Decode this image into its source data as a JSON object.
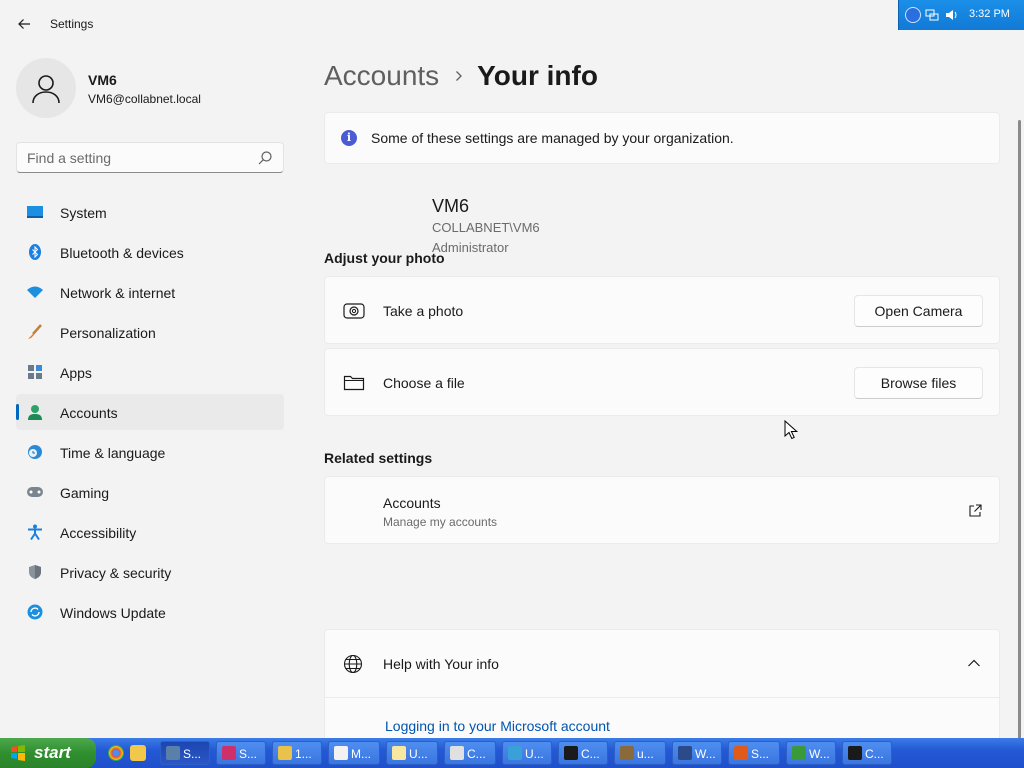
{
  "window": {
    "title": "Settings",
    "minimize_glyph": "—",
    "maximize_glyph": "❐",
    "close_glyph": "✕"
  },
  "profile": {
    "name": "VM6",
    "email": "VM6@collabnet.local"
  },
  "search": {
    "placeholder": "Find a setting"
  },
  "sidebar": {
    "items": [
      {
        "label": "System",
        "icon": "system-icon",
        "active": false
      },
      {
        "label": "Bluetooth & devices",
        "icon": "bluetooth-icon",
        "active": false
      },
      {
        "label": "Network & internet",
        "icon": "wifi-icon",
        "active": false
      },
      {
        "label": "Personalization",
        "icon": "brush-icon",
        "active": false
      },
      {
        "label": "Apps",
        "icon": "apps-icon",
        "active": false
      },
      {
        "label": "Accounts",
        "icon": "accounts-icon",
        "active": true
      },
      {
        "label": "Time & language",
        "icon": "clock-globe-icon",
        "active": false
      },
      {
        "label": "Gaming",
        "icon": "gamepad-icon",
        "active": false
      },
      {
        "label": "Accessibility",
        "icon": "accessibility-icon",
        "active": false
      },
      {
        "label": "Privacy & security",
        "icon": "shield-icon",
        "active": false
      },
      {
        "label": "Windows Update",
        "icon": "update-icon",
        "active": false
      }
    ]
  },
  "breadcrumb": {
    "parent": "Accounts",
    "current": "Your info"
  },
  "notice": {
    "text": "Some of these settings are managed by your organization."
  },
  "user": {
    "name": "VM6",
    "domain_account": "COLLABNET\\VM6",
    "role": "Administrator"
  },
  "adjust_photo": {
    "title": "Adjust your photo",
    "take_photo_label": "Take a photo",
    "open_camera_button": "Open Camera",
    "choose_file_label": "Choose a file",
    "browse_files_button": "Browse files"
  },
  "related": {
    "title": "Related settings",
    "accounts_title": "Accounts",
    "accounts_subtitle": "Manage my accounts"
  },
  "help": {
    "title": "Help with Your info",
    "link": "Logging in to your Microsoft account"
  },
  "taskbar": {
    "start_label": "start",
    "items": [
      {
        "label": "S...",
        "color": "#5a7fa8",
        "active": true
      },
      {
        "label": "S...",
        "color": "#d0306a",
        "active": false
      },
      {
        "label": "1...",
        "color": "#e8c24a",
        "active": false
      },
      {
        "label": "M...",
        "color": "#f2f2f2",
        "active": false
      },
      {
        "label": "U...",
        "color": "#f7e7a0",
        "active": false
      },
      {
        "label": "C...",
        "color": "#e0e0e0",
        "active": false
      },
      {
        "label": "U...",
        "color": "#3aa0d8",
        "active": false
      },
      {
        "label": "C...",
        "color": "#1a1a1a",
        "active": false
      },
      {
        "label": "u...",
        "color": "#8a6a3a",
        "active": false
      },
      {
        "label": "W...",
        "color": "#2a4a8a",
        "active": false
      },
      {
        "label": "S...",
        "color": "#e05a1a",
        "active": false
      },
      {
        "label": "W...",
        "color": "#3a9a3a",
        "active": false
      },
      {
        "label": "C...",
        "color": "#1a1a1a",
        "active": false
      }
    ],
    "clock": "3:32 PM"
  }
}
